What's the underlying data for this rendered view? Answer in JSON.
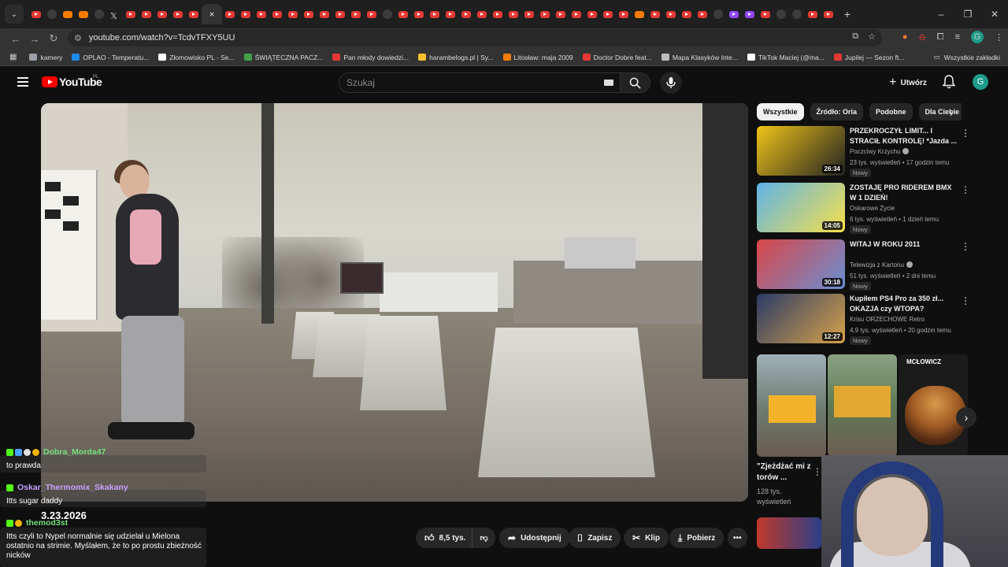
{
  "browser": {
    "active_tab_close": "×",
    "new_tab": "+",
    "window_controls": [
      "–",
      "❐",
      "✕"
    ],
    "url": "youtube.com/watch?v=TcdvTFXY5UU",
    "profile_letter": "G",
    "bookmarks": [
      {
        "label": "kamery",
        "color": "#9aa0a6"
      },
      {
        "label": "OPLAO - Temperatu...",
        "color": "#1e88e5"
      },
      {
        "label": "Złomowisko PL - Se...",
        "color": "#ffffff"
      },
      {
        "label": "ŚWIĄTECZNA PACZ...",
        "color": "#43a047"
      },
      {
        "label": "Pan młody dowiedzi...",
        "color": "#e53935"
      },
      {
        "label": "harambelogs.pl | Sy...",
        "color": "#fbc02d"
      },
      {
        "label": "Litosław: maja 2009",
        "color": "#f57c00"
      },
      {
        "label": "Doctor Dobre feat...",
        "color": "#e53935"
      },
      {
        "label": "Mapa Klasyków Inte...",
        "color": "#bdbdbd"
      },
      {
        "label": "TikTok Maciej (@ma...",
        "color": "#ffffff"
      },
      {
        "label": "Jupilej — Sezon ft...",
        "color": "#e53935"
      }
    ],
    "all_bookmarks": "Wszystkie zakładki"
  },
  "youtube": {
    "logo_text": "YouTube",
    "country": "PL",
    "search_placeholder": "Szukaj",
    "create_label": "Utwórz",
    "avatar_letter": "G"
  },
  "video": {
    "date_overlay": "3.23.2026"
  },
  "actions": {
    "likes": "8,5 tys.",
    "share": "Udostępnij",
    "save": "Zapisz",
    "clip": "Klip",
    "download": "Pobierz",
    "more": "•••"
  },
  "chips": [
    "Wszystkie",
    "Źródło: Oria",
    "Podobne",
    "Dla Ciebie"
  ],
  "recommendations": [
    {
      "title": "PRZEKROCZYŁ LIMIT... I STRACIŁ KONTROLĘ! *Jazda ...",
      "channel": "Poczciwy Krzychu",
      "verified": true,
      "meta": "23 tys. wyświetleń • 17 godzin temu",
      "badge": "Nowy",
      "duration": "26:34",
      "thumb_colors": [
        "#f0c419",
        "#222222"
      ]
    },
    {
      "title": "ZOSTAJĘ PRO RIDEREM BMX W 1 DZIEŃ!",
      "channel": "Oskarowe Życie",
      "verified": false,
      "meta": "6 tys. wyświetleń • 1 dzień temu",
      "badge": "Nowy",
      "duration": "14:05",
      "thumb_colors": [
        "#5fb3e8",
        "#f6e04a"
      ]
    },
    {
      "title": "WITAJ W ROKU 2011",
      "channel": "Telewizja z Kartonu",
      "verified": true,
      "meta": "51 tys. wyświetleń • 2 dni temu",
      "badge": "Nowy",
      "duration": "30:18",
      "thumb_colors": [
        "#d94646",
        "#6a8fd4"
      ]
    },
    {
      "title": "Kupiłem PS4 Pro za 350 zł... OKAZJA czy WTOPA?",
      "channel": "Krisu ORZECHOWE Retro",
      "verified": false,
      "meta": "4,9 tys. wyświetleń • 20 godzin temu",
      "badge": "Nowy",
      "duration": "12:27",
      "thumb_colors": [
        "#2a3b66",
        "#d8a24a"
      ]
    }
  ],
  "shorts": {
    "title": "\"Zjeżdżać mi z torów ...",
    "views": "128 tys. wyświetleń",
    "third_label": "MCŁOWICZ"
  },
  "chat": [
    {
      "user": "Dobra_Morda47",
      "message": "to prawda"
    },
    {
      "user": "Oskar_Thermomix_Skakany",
      "message": "Itts sugar daddy"
    },
    {
      "user": "themod3st",
      "message": "Itts czyli to Nypel normalnie się udzielał u Mielona ostatnio na strimie. Myślałem, że to po prostu zbieżność nicków"
    }
  ],
  "colors": {
    "yt_red": "#ff0000",
    "chat_user": "#72e07a",
    "background": "#0f0f0f"
  }
}
